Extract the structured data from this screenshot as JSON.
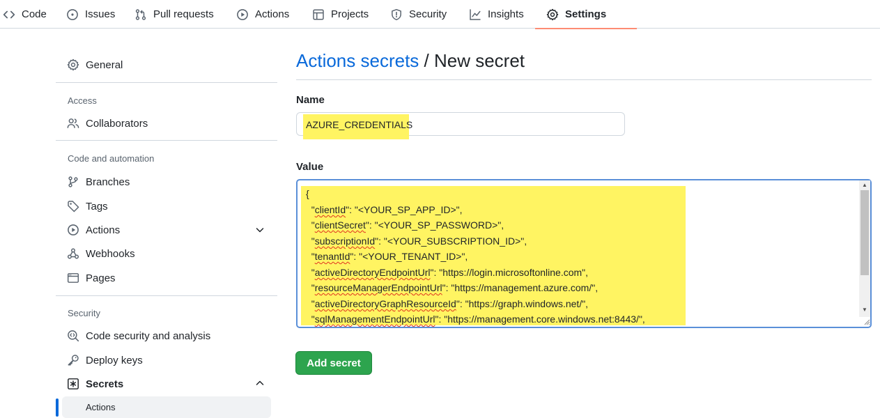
{
  "nav": {
    "tabs": [
      {
        "label": "Code",
        "icon": "code-icon"
      },
      {
        "label": "Issues",
        "icon": "issue-icon"
      },
      {
        "label": "Pull requests",
        "icon": "pull-request-icon"
      },
      {
        "label": "Actions",
        "icon": "play-icon"
      },
      {
        "label": "Projects",
        "icon": "table-icon"
      },
      {
        "label": "Security",
        "icon": "shield-icon"
      },
      {
        "label": "Insights",
        "icon": "graph-icon"
      },
      {
        "label": "Settings",
        "icon": "gear-icon",
        "active": true
      }
    ]
  },
  "sidebar": {
    "general": "General",
    "access_heading": "Access",
    "collaborators": "Collaborators",
    "code_heading": "Code and automation",
    "branches": "Branches",
    "tags": "Tags",
    "actions": "Actions",
    "webhooks": "Webhooks",
    "pages": "Pages",
    "security_heading": "Security",
    "code_security": "Code security and analysis",
    "deploy_keys": "Deploy keys",
    "secrets": "Secrets",
    "secrets_sub_actions": "Actions"
  },
  "main": {
    "breadcrumb_link": "Actions secrets",
    "breadcrumb_sep": " / ",
    "breadcrumb_current": "New secret",
    "name_label": "Name",
    "name_value": "AZURE_CREDENTIALS",
    "value_label": "Value",
    "value_lines": [
      {
        "pre": "{",
        "key": "",
        "post": ""
      },
      {
        "pre": "  \"",
        "key": "clientId",
        "post": "\": \"<YOUR_SP_APP_ID>\","
      },
      {
        "pre": "  \"",
        "key": "clientSecret",
        "post": "\": \"<YOUR_SP_PASSWORD>\","
      },
      {
        "pre": "  \"",
        "key": "subscriptionId",
        "post": "\": \"<YOUR_SUBSCRIPTION_ID>\","
      },
      {
        "pre": "  \"",
        "key": "tenantId",
        "post": "\": \"<YOUR_TENANT_ID>\","
      },
      {
        "pre": "  \"",
        "key": "activeDirectoryEndpointUrl",
        "post": "\": \"https://login.microsoftonline.com\","
      },
      {
        "pre": "  \"",
        "key": "resourceManagerEndpointUrl",
        "post": "\": \"https://management.azure.com/\","
      },
      {
        "pre": "  \"",
        "key": "activeDirectoryGraphResourceId",
        "post": "\": \"https://graph.windows.net/\","
      },
      {
        "pre": "  \"",
        "key": "sqlManagementEndpointUrl",
        "post": "\": \"https://management.core.windows.net:8443/\","
      }
    ],
    "submit_label": "Add secret"
  },
  "colors": {
    "link": "#0969da",
    "highlight": "#fff462",
    "primary_button": "#2da44e",
    "active_tab_underline": "#fd8c73",
    "focus_border": "#5a8fd8"
  }
}
